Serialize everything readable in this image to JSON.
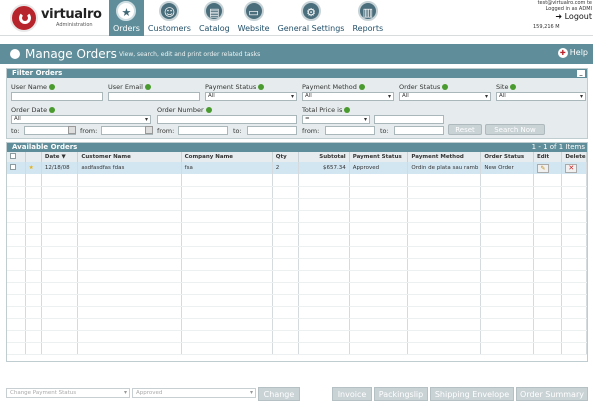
{
  "brand": {
    "name": "virtualro",
    "sub": "Administration"
  },
  "nav": [
    {
      "label": "Orders",
      "icon": "★",
      "name": "nav-orders",
      "active": true
    },
    {
      "label": "Customers",
      "icon": "☺",
      "name": "nav-customers"
    },
    {
      "label": "Catalog",
      "icon": "▤",
      "name": "nav-catalog"
    },
    {
      "label": "Website",
      "icon": "▭",
      "name": "nav-website"
    },
    {
      "label": "General Settings",
      "icon": "⚙",
      "name": "nav-general-settings"
    },
    {
      "label": "Reports",
      "icon": "▥",
      "name": "nav-reports"
    }
  ],
  "user": {
    "email": "test@virtualro.com te",
    "logged": "Logged in as ADMI",
    "logout": "Logout",
    "memory": "159,216 M"
  },
  "page": {
    "title": "Manage Orders",
    "desc": "View, search, edit and print order related tasks",
    "help": "Help"
  },
  "filter": {
    "title": "Filter Orders",
    "collapse": "_",
    "user_name": "User Name",
    "user_email": "User Email",
    "payment_status": "Payment Status",
    "payment_method": "Payment Method",
    "order_status": "Order Status",
    "site": "Site",
    "payment_status_val": "All",
    "payment_method_val": "All",
    "order_status_val": "All",
    "site_val": "All",
    "order_date": "Order Date",
    "order_date_val": "All",
    "to": "to:",
    "from": "from:",
    "order_number": "Order Number",
    "order_from": "from:",
    "order_to": "to:",
    "total_price": "Total Price is",
    "total_price_val": "=",
    "price_from": "from:",
    "price_to": "to:",
    "reset": "Reset",
    "search": "Search Now"
  },
  "orders": {
    "title": "Available Orders",
    "count": "1 - 1 of 1 Items",
    "columns": [
      "",
      "",
      "Date",
      "Customer Name",
      "Company Name",
      "Qty",
      "Subtotal",
      "Payment Status",
      "Payment Method",
      "Order Status",
      "Edit",
      "Delete"
    ],
    "rows": [
      {
        "date": "12/18/08",
        "customer": "asdfasdfas fdas",
        "company": "fsa",
        "qty": "2",
        "subtotal": "$657.34",
        "payment_status": "Approved",
        "payment_method": "Ordin de plata sau ramb",
        "order_status": "New Order"
      }
    ]
  },
  "footer": {
    "change_payment": "Change Payment Status",
    "approved": "Approved",
    "change": "Change",
    "invoice": "Invoice",
    "packingslip": "Packingslip",
    "shipping": "Shipping Envelope",
    "summary": "Order Summary"
  }
}
